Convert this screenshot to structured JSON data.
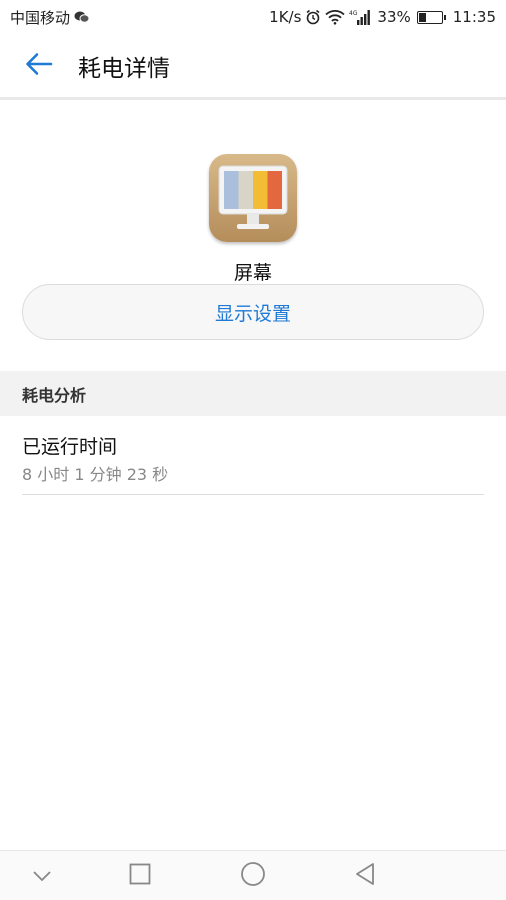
{
  "status_bar": {
    "carrier": "中国移动",
    "network_speed": "1K/s",
    "network_type": "4G",
    "battery": "33%",
    "battery_level": 0.33,
    "time": "11:35",
    "icons": [
      "wechat-icon",
      "alarm-icon",
      "wifi-icon",
      "signal-icon",
      "battery-icon"
    ]
  },
  "header": {
    "title": "耗电详情",
    "back_icon": "arrow-left-icon"
  },
  "app": {
    "name": "屏幕",
    "icon": "display-icon",
    "settings_button": "显示设置"
  },
  "analysis": {
    "section_title": "耗电分析",
    "items": [
      {
        "label": "已运行时间",
        "value": "8 小时 1 分钟 23 秒"
      }
    ]
  },
  "nav_bar": {
    "buttons": [
      "collapse-icon",
      "recents-icon",
      "home-icon",
      "back-icon"
    ]
  },
  "colors": {
    "accent": "#1f7ad6",
    "section_bg": "#f2f2f2",
    "icon_wood": "#c7a46f"
  }
}
